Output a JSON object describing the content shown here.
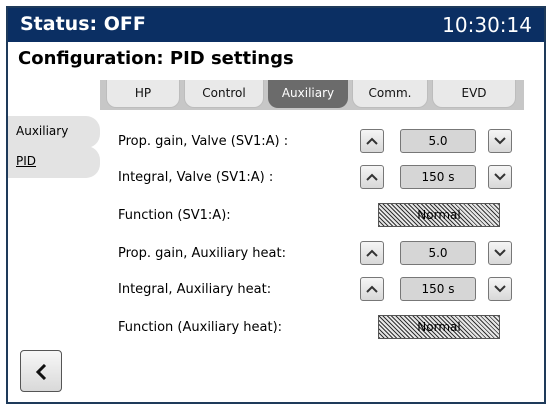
{
  "status": {
    "text": "Status: OFF",
    "time": "10:30:14"
  },
  "title": "Configuration: PID settings",
  "tabs": [
    {
      "label": "HP",
      "active": false
    },
    {
      "label": "Control",
      "active": false
    },
    {
      "label": "Auxiliary",
      "active": true
    },
    {
      "label": "Comm.",
      "active": false
    },
    {
      "label": "EVD",
      "active": false
    }
  ],
  "side_menu": [
    {
      "label": "Auxiliary"
    },
    {
      "label": "PID"
    }
  ],
  "rows": [
    {
      "label": "Prop. gain, Valve (SV1:A) :",
      "value": "5.0",
      "type": "stepper"
    },
    {
      "label": "Integral, Valve (SV1:A) :",
      "value": "150 s",
      "type": "stepper"
    },
    {
      "label": "Function (SV1:A):",
      "value": "Normal",
      "type": "status"
    },
    {
      "label": "Prop. gain, Auxiliary heat:",
      "value": "5.0",
      "type": "stepper"
    },
    {
      "label": "Integral, Auxiliary heat:",
      "value": "150 s",
      "type": "stepper"
    },
    {
      "label": "Function (Auxiliary heat):",
      "value": "Normal",
      "type": "status"
    }
  ],
  "icons": {
    "up": "chevron-up-icon",
    "down": "chevron-down-icon",
    "back": "chevron-left-icon"
  },
  "colors": {
    "status_bar": "#0b2f63",
    "active_tab": "#6b6b6b",
    "inactive_tab": "#e9e9e9"
  }
}
